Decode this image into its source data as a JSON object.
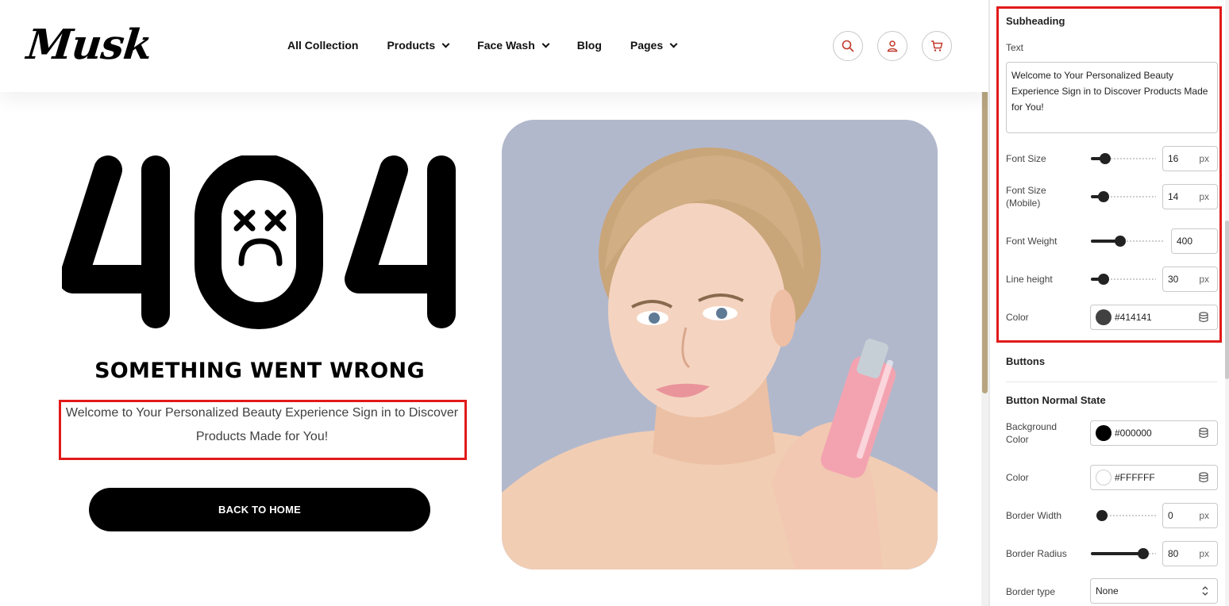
{
  "site": {
    "logo": "Musk",
    "nav": [
      {
        "label": "All Collection",
        "dropdown": false
      },
      {
        "label": "Products",
        "dropdown": true
      },
      {
        "label": "Face Wash",
        "dropdown": true
      },
      {
        "label": "Blog",
        "dropdown": false
      },
      {
        "label": "Pages",
        "dropdown": true
      }
    ],
    "icons": [
      "search-icon",
      "user-icon",
      "cart-icon"
    ],
    "accent_color": "#c0392b"
  },
  "error": {
    "code": "404",
    "heading": "SOMETHING WENT WRONG",
    "subheading": "Welcome to Your Personalized Beauty Experience Sign in to Discover Products Made for You!",
    "button": "BACK TO HOME"
  },
  "panel": {
    "subheading": {
      "title": "Subheading",
      "text_label": "Text",
      "text_value": "Welcome to Your Personalized Beauty Experience Sign in to Discover Products Made for You!",
      "font_size": {
        "label": "Font Size",
        "value": "16",
        "unit": "px",
        "level": 0.22
      },
      "font_size_mobile": {
        "label": "Font Size (Mobile)",
        "value": "14",
        "unit": "px",
        "level": 0.19
      },
      "font_weight": {
        "label": "Font Weight",
        "value": "400",
        "level": 0.4
      },
      "line_height": {
        "label": "Line height",
        "value": "30",
        "unit": "px",
        "level": 0.2
      },
      "color": {
        "label": "Color",
        "value": "#414141"
      }
    },
    "buttons": {
      "title": "Buttons",
      "normal_state_title": "Button Normal State",
      "background_color": {
        "label": "Background Color",
        "value": "#000000"
      },
      "color": {
        "label": "Color",
        "value": "#FFFFFF"
      },
      "border_width": {
        "label": "Border Width",
        "value": "0",
        "unit": "px",
        "level": 0.0
      },
      "border_radius": {
        "label": "Border Radius",
        "value": "80",
        "unit": "px",
        "level": 0.8
      },
      "border_type": {
        "label": "Border type",
        "value": "None"
      }
    }
  },
  "highlight_color": "#e11a1a"
}
